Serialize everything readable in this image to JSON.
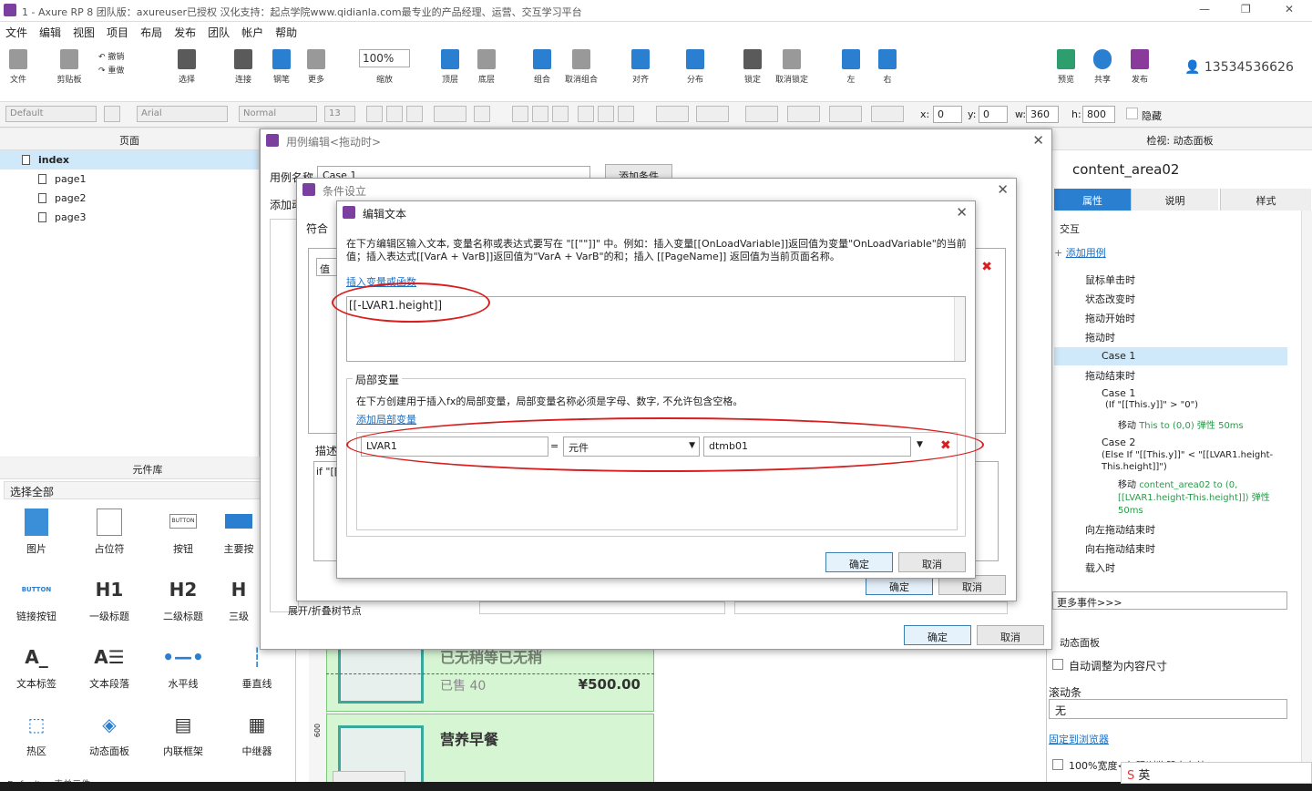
{
  "app": {
    "title": "1 - Axure RP 8 团队版：axureuser已授权 汉化支持：起点学院www.qidianla.com最专业的产品经理、运营、交互学习平台"
  },
  "menu": [
    "文件",
    "编辑",
    "视图",
    "项目",
    "布局",
    "发布",
    "团队",
    "帐户",
    "帮助"
  ],
  "toolbar": {
    "file": "文件",
    "clipboard": "剪贴板",
    "undo": "撤销",
    "redo": "重做",
    "select": "选择",
    "connect": "连接",
    "pen": "钢笔",
    "more": "更多",
    "zoom": "100%",
    "zoom_label": "缩放",
    "top": "顶层",
    "bottom": "底层",
    "group": "组合",
    "ungroup": "取消组合",
    "align": "对齐",
    "distribute": "分布",
    "lock": "锁定",
    "unlock": "取消锁定",
    "left": "左",
    "right": "右",
    "preview": "预览",
    "share": "共享",
    "publish": "发布",
    "user": "13534536626"
  },
  "format": {
    "style": "Default",
    "font": "Arial",
    "weight": "Normal",
    "size": "13",
    "x_label": "x:",
    "x": "0",
    "y_label": "y:",
    "y": "0",
    "w_label": "w:",
    "w": "360",
    "h_label": "h:",
    "h": "800",
    "hide": "隐藏"
  },
  "pages": {
    "header": "页面",
    "items": [
      "index",
      "page1",
      "page2",
      "page3"
    ]
  },
  "library": {
    "header": "元件库",
    "filter": "选择全部",
    "items": [
      "图片",
      "占位符",
      "按钮",
      "主要按",
      "链接按钮",
      "一级标题",
      "二级标题",
      "三级",
      "文本标签",
      "文本段落",
      "水平线",
      "垂直线",
      "热区",
      "动态面板",
      "内联框架",
      "中继器"
    ],
    "glyphs": {
      "button": "BUTTON",
      "h1": "H1",
      "h2": "H2",
      "h3": "H"
    },
    "footer": "Default > 表单元件"
  },
  "canvas": {
    "sold": "已售 40",
    "price": "¥500.00",
    "title2": "营养早餐",
    "ruler": "600",
    "faded_title": "已无稍等已无稍"
  },
  "inspector": {
    "header": "检视: 动态面板",
    "name": "content_area02",
    "tabs": [
      "属性",
      "说明",
      "样式"
    ],
    "interaction": "交互",
    "add_case": "添加用例",
    "events": [
      "鼠标单击时",
      "状态改变时",
      "拖动开始时",
      "拖动时",
      "拖动结束时",
      "向左拖动结束时",
      "向右拖动结束时",
      "载入时"
    ],
    "case1_drag": "Case 1",
    "end_case1": "Case 1",
    "end_case1_cond": "(If \"[[This.y]]\" > \"0\")",
    "end_case1_act_a": "移动",
    "end_case1_act_b": "This to (0,0) 弹性 50ms",
    "end_case2": "Case 2",
    "end_case2_cond": "(Else If \"[[This.y]]\" < \"[[LVAR1.height-This.height]]\")",
    "end_case2_act_a": "移动",
    "end_case2_act_b": "content_area02 to (0, [[LVAR1.height-This.height]]) 弹性 50ms",
    "more_events": "更多事件>>>",
    "panel": "动态面板",
    "autofit": "自动调整为内容尺寸",
    "scroll": "滚动条",
    "scroll_val": "无",
    "pin": "固定到浏览器",
    "width100": "100%宽度<仅限浏览器中有效"
  },
  "dlg1": {
    "title": "用例编辑<拖动时>",
    "case_name_label": "用例名称",
    "case_name": "Case 1",
    "add_cond": "添加条件",
    "add_label": "添加动",
    "ok": "确定",
    "cancel": "取消",
    "expand": "展开/折叠树节点"
  },
  "dlg2": {
    "title": "条件设立",
    "match": "符合",
    "value": "值",
    "desc": "描述",
    "desc_text": "if \"[[",
    "ok": "确定",
    "cancel": "取消"
  },
  "dlg3": {
    "title": "编辑文本",
    "instructions": "在下方编辑区输入文本, 变量名称或表达式要写在 \"[[\"\"]]\" 中。例如：插入变量[[OnLoadVariable]]返回值为变量\"OnLoadVariable\"的当前值；插入表达式[[VarA + VarB]]返回值为\"VarA + VarB\"的和；插入 [[PageName]] 返回值为当前页面名称。",
    "insert_link": "插入变量或函数",
    "expression": "[[-LVAR1.height]]",
    "local_title": "局部变量",
    "local_desc": "在下方创建用于插入fx的局部变量，局部变量名称必须是字母、数字, 不允许包含空格。",
    "add_local": "添加局部变量",
    "var_name": "LVAR1",
    "eq": "=",
    "var_type": "元件",
    "var_target": "dtmb01",
    "ok": "确定",
    "cancel": "取消"
  },
  "taskbar": {
    "ime": "英"
  },
  "colors": {
    "accent": "#7b3fa0",
    "selection": "#cfe8fa",
    "red": "#d81e1e",
    "green": "#2a9a4a",
    "link": "#1a6fc2"
  }
}
